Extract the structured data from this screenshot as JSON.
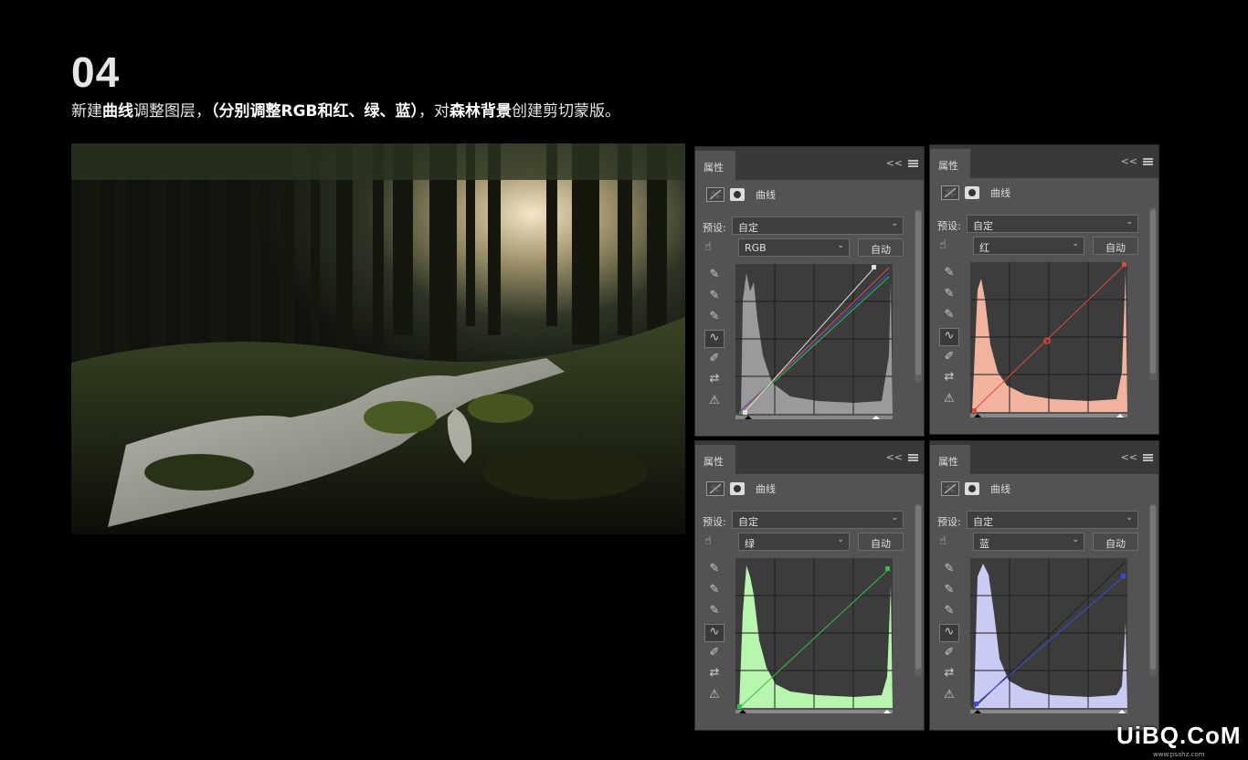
{
  "header": {
    "step": "04",
    "instruction": {
      "p1": "新建",
      "b1": "曲线",
      "p2": "调整图层，",
      "b2": "（分别调整RGB和红、绿、蓝）",
      "p3": "，对",
      "b3": "森林背景",
      "p4": "创建剪切蒙版。"
    }
  },
  "panels": [
    {
      "tab": "属性",
      "collapse": "<<",
      "title": "曲线",
      "preset_label": "预设:",
      "preset": "自定",
      "channel": "RGB",
      "auto": "自动",
      "curve_color": "#bbbbbb",
      "hist_color": "#9a9a9a",
      "icons": [
        "hand-target-icon",
        "eyedropper-black-icon",
        "eyedropper-gray-icon",
        "eyedropper-white-icon",
        "curve-tool-icon",
        "pencil-icon",
        "smooth-icon",
        "histogram-warning-icon"
      ]
    },
    {
      "tab": "属性",
      "collapse": "<<",
      "title": "曲线",
      "preset_label": "预设:",
      "preset": "自定",
      "channel": "红",
      "auto": "自动",
      "curve_color": "#e04a3a",
      "hist_color": "#f2b39e"
    },
    {
      "tab": "属性",
      "collapse": "<<",
      "title": "曲线",
      "preset_label": "预设:",
      "preset": "自定",
      "channel": "绿",
      "auto": "自动",
      "curve_color": "#33c04a",
      "hist_color": "#b8f5ae"
    },
    {
      "tab": "属性",
      "collapse": "<<",
      "title": "曲线",
      "preset_label": "预设:",
      "preset": "自定",
      "channel": "蓝",
      "auto": "自动",
      "curve_color": "#3a4ce0",
      "hist_color": "#c9cbf5"
    }
  ],
  "watermark": {
    "main": "UiBQ.CoM",
    "sub": "www.psahz.com"
  }
}
